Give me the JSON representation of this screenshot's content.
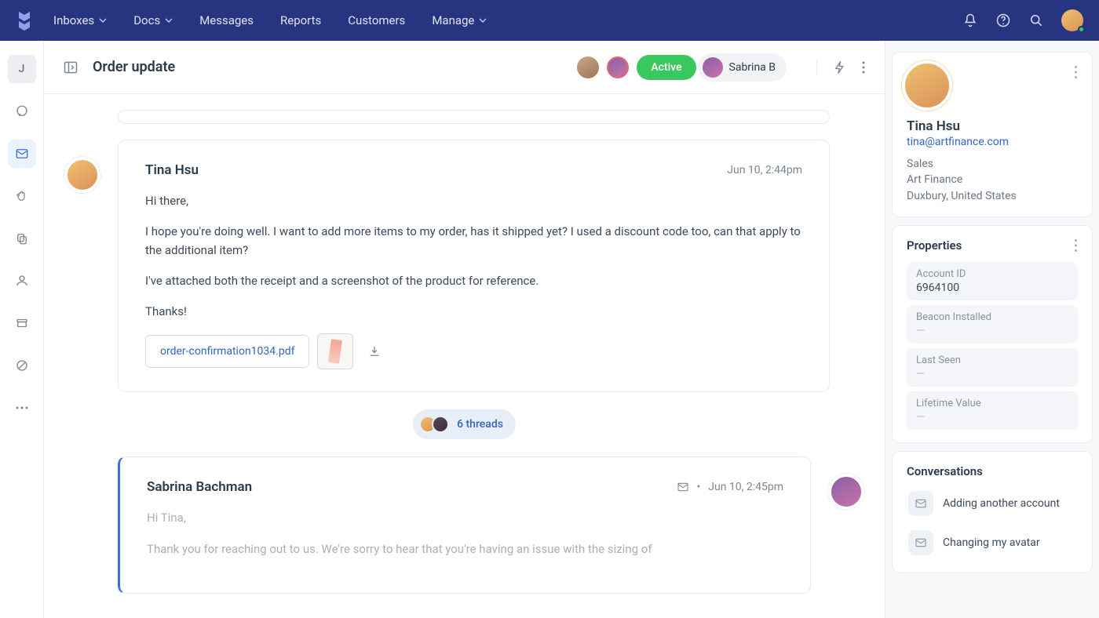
{
  "topnav": {
    "items": [
      {
        "label": "Inboxes",
        "hasDropdown": true
      },
      {
        "label": "Docs",
        "hasDropdown": true
      },
      {
        "label": "Messages",
        "hasDropdown": false
      },
      {
        "label": "Reports",
        "hasDropdown": false
      },
      {
        "label": "Customers",
        "hasDropdown": false
      },
      {
        "label": "Manage",
        "hasDropdown": true
      }
    ]
  },
  "leftRail": {
    "initial": "J"
  },
  "conversation": {
    "title": "Order update",
    "status": "Active",
    "assignee": "Sabrina B",
    "threads_label": "6 threads"
  },
  "messages": {
    "customer": {
      "name": "Tina Hsu",
      "timestamp": "Jun 10, 2:44pm",
      "p1": "Hi there,",
      "p2": "I hope you're doing well. I want to add more items to my order, has it shipped yet? I used a discount code too, can that apply to the additional item?",
      "p3": "I've attached both the receipt and a screenshot of the product for reference.",
      "p4": "Thanks!",
      "attachment_pdf": "order-confirmation1034.pdf"
    },
    "reply": {
      "name": "Sabrina Bachman",
      "timestamp": "Jun 10, 2:45pm",
      "p1": "Hi Tina,",
      "p2": "Thank you for reaching out to us. We're sorry to hear that you're having an issue with the sizing of"
    }
  },
  "profile": {
    "name": "Tina Hsu",
    "email": "tina@artfinance.com",
    "role": "Sales",
    "company": "Art Finance",
    "location": "Duxbury, United States"
  },
  "properties": {
    "title": "Properties",
    "items": [
      {
        "label": "Account ID",
        "value": "6964100"
      },
      {
        "label": "Beacon Installed",
        "value": "—"
      },
      {
        "label": "Last Seen",
        "value": "—"
      },
      {
        "label": "Lifetime Value",
        "value": "—"
      }
    ]
  },
  "conversations_panel": {
    "title": "Conversations",
    "items": [
      {
        "label": "Adding another account"
      },
      {
        "label": "Changing my avatar"
      }
    ]
  }
}
